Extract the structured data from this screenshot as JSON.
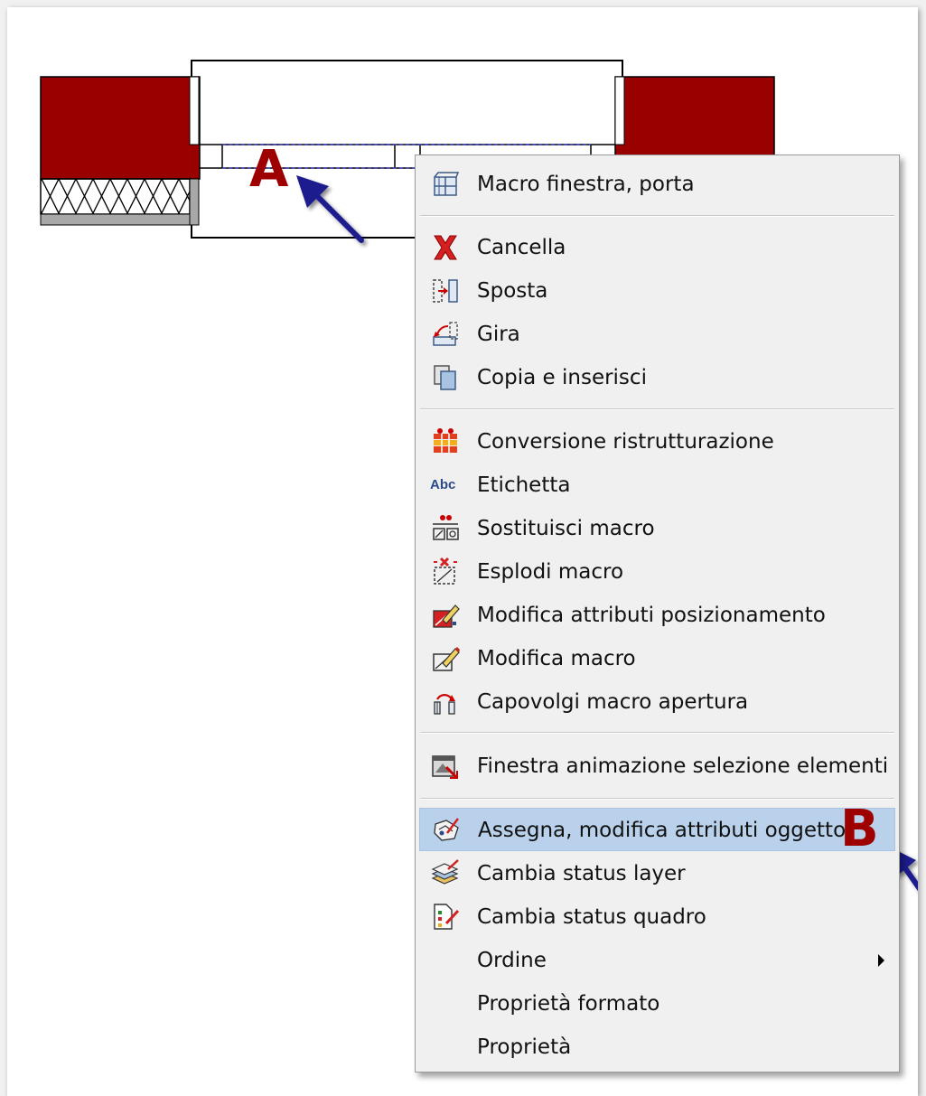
{
  "annotations": {
    "label_a": "A",
    "label_b": "B",
    "label_color": "#9e0000",
    "arrow_color": "#1a1f8f"
  },
  "drawing": {
    "wall_color": "#990000",
    "insulation_pattern": "cross-hatch"
  },
  "context_menu": {
    "highlight_color": "#b9d1ea",
    "items": [
      {
        "label": "Macro finestra, porta",
        "icon": "window-macro-icon"
      },
      {
        "label": "Cancella",
        "icon": "delete-icon"
      },
      {
        "label": "Sposta",
        "icon": "move-icon"
      },
      {
        "label": "Gira",
        "icon": "rotate-icon"
      },
      {
        "label": "Copia e inserisci",
        "icon": "copy-paste-icon"
      },
      {
        "label": "Conversione ristrutturazione",
        "icon": "renovation-conversion-icon"
      },
      {
        "label": "Etichetta",
        "icon": "label-abc-icon",
        "icon_text": "Abc"
      },
      {
        "label": "Sostituisci macro",
        "icon": "replace-macro-icon"
      },
      {
        "label": "Esplodi macro",
        "icon": "explode-macro-icon"
      },
      {
        "label": "Modifica attributi posizionamento",
        "icon": "modify-placement-icon"
      },
      {
        "label": "Modifica macro",
        "icon": "modify-macro-icon"
      },
      {
        "label": "Capovolgi macro apertura",
        "icon": "flip-opening-icon"
      },
      {
        "label": "Finestra animazione selezione elementi",
        "icon": "animation-window-icon"
      },
      {
        "label": "Assegna, modifica attributi oggetto",
        "icon": "object-attributes-icon",
        "highlighted": true
      },
      {
        "label": "Cambia status layer",
        "icon": "layer-status-icon"
      },
      {
        "label": "Cambia status quadro",
        "icon": "drawing-status-icon"
      },
      {
        "label": "Ordine",
        "icon": "none",
        "has_submenu": true
      },
      {
        "label": "Proprietà formato",
        "icon": "none"
      },
      {
        "label": "Proprietà",
        "icon": "none"
      }
    ]
  }
}
